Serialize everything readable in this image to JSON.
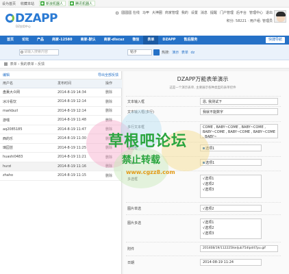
{
  "topbar": {
    "links": [
      "设为首页",
      "收藏本站"
    ],
    "pills": [
      "新浪机器人",
      "腾讯机器人"
    ]
  },
  "header": {
    "logo_word": "DZAPP",
    "logo_sub": "DZ应用中心",
    "user_links": [
      "圆圆圆 在线",
      "马甲",
      "大神圈",
      "商家管理",
      "我的",
      "设置",
      "消息",
      "提醒",
      "门户管理",
      "后平台",
      "管理中心",
      "退出"
    ],
    "user_info": "积分: 58221 · 用户组: 管理员"
  },
  "nav": {
    "items": [
      "首页",
      "论坛",
      "产品",
      "商家-12580",
      "商家-默认",
      "商家-dlscuz",
      "微信",
      "表单",
      "DZAPP",
      "售后服务"
    ],
    "active_index": 7,
    "quick": "快捷导航"
  },
  "subnav": {
    "search_placeholder": "请输入搜索内容",
    "select_value": "帖子",
    "hot_label": "热搜:",
    "hot_items": [
      "演示",
      "表单",
      "dz"
    ]
  },
  "breadcrumb": {
    "items": [
      "表单",
      "我的表单",
      "反馈"
    ]
  },
  "list": {
    "title": "编辑",
    "export": "导出全部反馈",
    "headers": [
      "用户名",
      "发布时间",
      "操作"
    ],
    "rows": [
      {
        "user": "盘薰大众网",
        "time": "2014-8-19 14:34",
        "action": "删除"
      },
      {
        "user": "冰冷看饮",
        "time": "2014-8-19 12:14",
        "action": "删除"
      },
      {
        "user": "markbuil",
        "time": "2014-8-19 12:14",
        "action": "删除"
      },
      {
        "user": "游嘿",
        "time": "2014-8-19 11:48",
        "action": "删除"
      },
      {
        "user": "aq2085185",
        "time": "2014-8-19 11:47",
        "action": "删除"
      },
      {
        "user": "西的乐",
        "time": "2014-8-19 11:30",
        "action": "删除"
      },
      {
        "user": "璃园芸",
        "time": "2014-8-19 11:25",
        "action": "删除"
      },
      {
        "user": "huashi0483",
        "time": "2014-8-19 11:21",
        "action": "删除"
      },
      {
        "user": "hurzi",
        "time": "2014-8-19 11:16",
        "action": "删除"
      },
      {
        "user": "zhaho",
        "time": "2014-8-19 11:15",
        "action": "删除"
      }
    ],
    "selected_index": 8
  },
  "form": {
    "title": "DZAPP万能表单演示",
    "desc": "这是一个演示表单, 主要展示各种类型的表单控件",
    "fields": {
      "text_label": "文本输入框",
      "text_value": "恩, 我测试下",
      "textarea_label": "文本输入框(多行)",
      "textarea_value": "我就不能数字",
      "longtext_label": "多行文本框",
      "longtext_value": "COME , BABY~COME , BABY~COME , BABY~COME , BABY~COME , BABY~COME , BABY~",
      "radio_label": "单选框",
      "radio_value": "选项1",
      "select_label": "下拉",
      "select_value": "选项1",
      "check_label": "多选框",
      "check_options": [
        "选项1",
        "选项2",
        "选项3"
      ],
      "img_radio_label": "图片单选",
      "img_radio_value": "选项2",
      "img_check_label": "图片多选",
      "img_check_options": [
        "选项1",
        "选项2",
        "选项3"
      ],
      "attach_label": "附件",
      "attach_value": "201408/19/112225lkeljub75dlpd47pu.gif",
      "date_label": "日期",
      "date_value": "2014-08-19 11:24"
    }
  },
  "watermark": {
    "line1": "草根吧论坛",
    "line2": "禁止转载",
    "line3": "www.cgzz8.com"
  }
}
